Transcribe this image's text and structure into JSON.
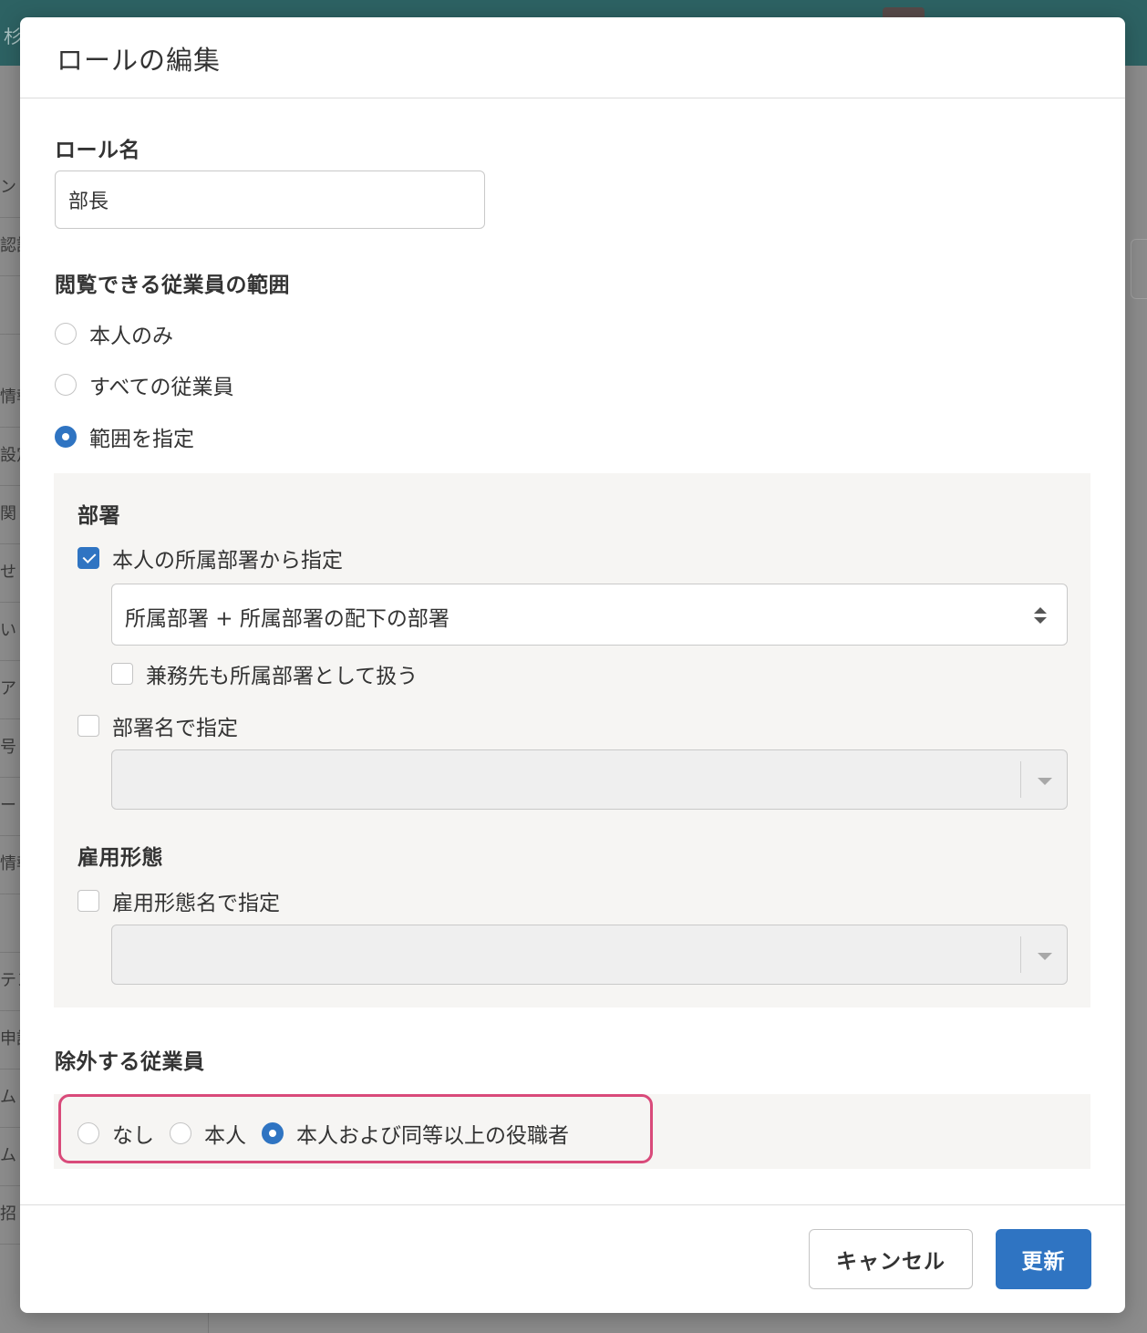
{
  "background": {
    "header_fragment": "杉",
    "sidebar_fragments": [
      "ン",
      "認証",
      "",
      "",
      "情報",
      "設定",
      "関",
      "せ",
      "い",
      "ア",
      "号",
      "ー",
      "情報",
      "",
      "テン",
      "申請",
      "ム",
      "ム",
      "招"
    ]
  },
  "modal": {
    "title": "ロールの編集",
    "role_name": {
      "label": "ロール名",
      "value": "部長"
    },
    "view_scope": {
      "label": "閲覧できる従業員の範囲",
      "options": [
        {
          "label": "本人のみ",
          "checked": false
        },
        {
          "label": "すべての従業員",
          "checked": false
        },
        {
          "label": "範囲を指定",
          "checked": true
        }
      ]
    },
    "department": {
      "label": "部署",
      "by_own_department": {
        "label": "本人の所属部署から指定",
        "checked": true
      },
      "department_select_value": "所属部署 + 所属部署の配下の部署",
      "concurrent": {
        "label": "兼務先も所属部署として扱う",
        "checked": false
      },
      "by_name": {
        "label": "部署名で指定",
        "checked": false
      }
    },
    "employment_type": {
      "label": "雇用形態",
      "by_name": {
        "label": "雇用形態名で指定",
        "checked": false
      }
    },
    "exclude": {
      "label": "除外する従業員",
      "options": [
        {
          "label": "なし",
          "checked": false
        },
        {
          "label": "本人",
          "checked": false
        },
        {
          "label": "本人および同等以上の役職者",
          "checked": true
        }
      ]
    },
    "footer": {
      "cancel_label": "キャンセル",
      "update_label": "更新"
    }
  },
  "colors": {
    "accent": "#2f74c2",
    "highlight_border": "#d94a7a",
    "header_bg": "#2d6263"
  }
}
